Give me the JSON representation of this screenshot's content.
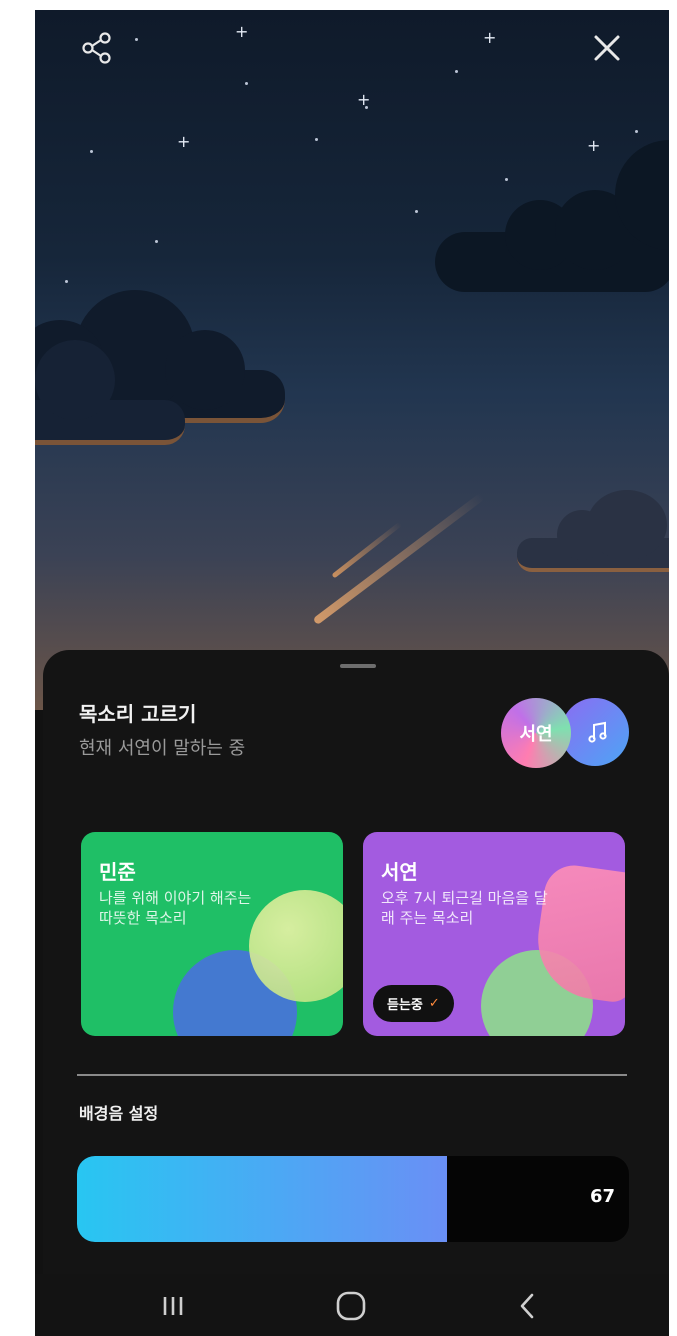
{
  "top_bar": {
    "share_icon": "share-icon",
    "close_icon": "close-icon"
  },
  "voice_picker": {
    "title": "목소리 고르기",
    "subtitle": "현재 서연이 말하는 중",
    "current_voice_avatar": "서연",
    "music_icon": "music-note-icon"
  },
  "voices": [
    {
      "name": "민준",
      "description": "나를 위해 이야기 해주는 따뜻한 목소리",
      "color": "#1fbf66",
      "listening": false
    },
    {
      "name": "서연",
      "description": "오후 7시 퇴근길 마음을 달래 주는 목소리",
      "color": "#a35be0",
      "listening": true,
      "badge_label": "듣는중",
      "badge_icon": "check-icon"
    }
  ],
  "background_music": {
    "label": "배경음 설정",
    "volume": 67,
    "volume_fraction": 0.67
  },
  "nav": {
    "recent_icon": "recent-apps-icon",
    "home_icon": "home-icon",
    "back_icon": "back-icon"
  },
  "colors": {
    "sheet_bg": "#141414",
    "slider_start": "#28c6f2",
    "slider_end": "#6a8ff5",
    "accent_check": "#ff8a3c"
  }
}
